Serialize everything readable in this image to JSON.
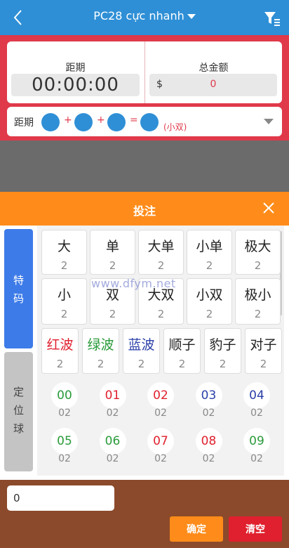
{
  "header": {
    "title": "PC28 cực nhanh"
  },
  "period": {
    "label": "距期",
    "timer": "00:00:00"
  },
  "total": {
    "label": "总金额",
    "currency": "$",
    "value": "0"
  },
  "draw": {
    "label": "距期",
    "plus1": "+",
    "plus2": "+",
    "equals": "=",
    "result": "(小双)"
  },
  "panel": {
    "title": "投注"
  },
  "tabs": {
    "special": "特码",
    "position": "定位球"
  },
  "bets": [
    {
      "name": "大",
      "odds": "2",
      "color": "#222222"
    },
    {
      "name": "单",
      "odds": "2",
      "color": "#222222"
    },
    {
      "name": "大单",
      "odds": "2",
      "color": "#222222"
    },
    {
      "name": "小单",
      "odds": "2",
      "color": "#222222"
    },
    {
      "name": "极大",
      "odds": "2",
      "color": "#222222"
    },
    {
      "name": "小",
      "odds": "2",
      "color": "#222222"
    },
    {
      "name": "双",
      "odds": "2",
      "color": "#222222"
    },
    {
      "name": "大双",
      "odds": "2",
      "color": "#222222"
    },
    {
      "name": "小双",
      "odds": "2",
      "color": "#222222"
    },
    {
      "name": "极小",
      "odds": "2",
      "color": "#222222"
    },
    {
      "name": "红波",
      "odds": "2",
      "color": "#e0202e"
    },
    {
      "name": "绿波",
      "odds": "2",
      "color": "#2a9a3a"
    },
    {
      "name": "蓝波",
      "odds": "2",
      "color": "#2a3fa8"
    },
    {
      "name": "顺子",
      "odds": "2",
      "color": "#222222"
    },
    {
      "name": "豹子",
      "odds": "2",
      "color": "#222222"
    },
    {
      "name": "对子",
      "odds": "2",
      "color": "#222222"
    }
  ],
  "numbers": [
    {
      "n": "00",
      "odds": "02",
      "color": "#2a9a3a"
    },
    {
      "n": "01",
      "odds": "02",
      "color": "#e0202e"
    },
    {
      "n": "02",
      "odds": "02",
      "color": "#e0202e"
    },
    {
      "n": "03",
      "odds": "02",
      "color": "#2a3fa8"
    },
    {
      "n": "04",
      "odds": "02",
      "color": "#2a3fa8"
    },
    {
      "n": "05",
      "odds": "02",
      "color": "#2a9a3a"
    },
    {
      "n": "06",
      "odds": "02",
      "color": "#2a9a3a"
    },
    {
      "n": "07",
      "odds": "02",
      "color": "#e0202e"
    },
    {
      "n": "08",
      "odds": "02",
      "color": "#e0202e"
    },
    {
      "n": "09",
      "odds": "02",
      "color": "#2a9a3a"
    }
  ],
  "watermark": "www.dfym.net",
  "footer": {
    "amount": "0",
    "confirm": "确定",
    "clear": "清空"
  }
}
